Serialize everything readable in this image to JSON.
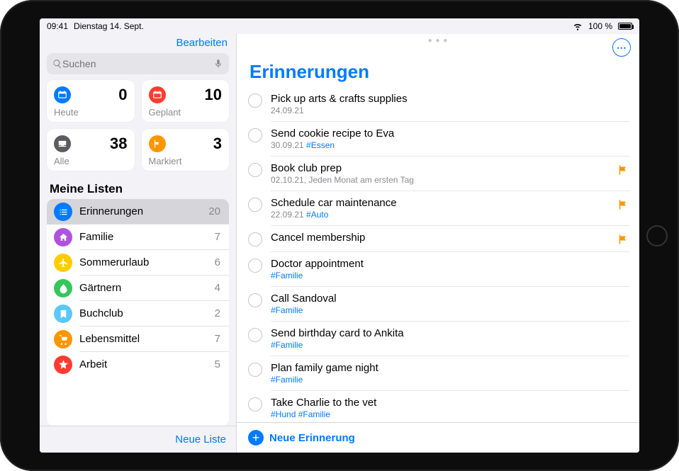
{
  "statusbar": {
    "time": "09:41",
    "date": "Dienstag 14. Sept.",
    "battery": "100 %"
  },
  "sidebar": {
    "edit": "Bearbeiten",
    "search_placeholder": "Suchen",
    "smart": [
      {
        "label": "Heute",
        "count": "0",
        "color": "#007aff",
        "icon": "calendar"
      },
      {
        "label": "Geplant",
        "count": "10",
        "color": "#ff3b30",
        "icon": "calendar"
      },
      {
        "label": "Alle",
        "count": "38",
        "color": "#5b5b60",
        "icon": "tray"
      },
      {
        "label": "Markiert",
        "count": "3",
        "color": "#ff9500",
        "icon": "flag"
      }
    ],
    "myLists": "Meine Listen",
    "lists": [
      {
        "name": "Erinnerungen",
        "count": "20",
        "color": "#007aff",
        "icon": "list",
        "selected": true
      },
      {
        "name": "Familie",
        "count": "7",
        "color": "#af52de",
        "icon": "house"
      },
      {
        "name": "Sommerurlaub",
        "count": "6",
        "color": "#ffcc00",
        "icon": "plane"
      },
      {
        "name": "Gärtnern",
        "count": "4",
        "color": "#34c759",
        "icon": "leaf"
      },
      {
        "name": "Buchclub",
        "count": "2",
        "color": "#5ac8fa",
        "icon": "bookmark"
      },
      {
        "name": "Lebensmittel",
        "count": "7",
        "color": "#ff9500",
        "icon": "cart"
      },
      {
        "name": "Arbeit",
        "count": "5",
        "color": "#ff3b30",
        "icon": "star"
      }
    ],
    "newList": "Neue Liste"
  },
  "main": {
    "title": "Erinnerungen",
    "newReminder": "Neue Erinnerung",
    "items": [
      {
        "title": "Pick up arts & crafts supplies",
        "date": "24.09.21",
        "tags": "",
        "flagged": false
      },
      {
        "title": "Send cookie recipe to Eva",
        "date": "30.09.21",
        "tags": "#Essen",
        "flagged": false
      },
      {
        "title": "Book club prep",
        "date": "02.10.21, Jeden Monat am ersten Tag",
        "tags": "",
        "flagged": true
      },
      {
        "title": "Schedule car maintenance",
        "date": "22.09.21",
        "tags": "#Auto",
        "flagged": true
      },
      {
        "title": "Cancel membership",
        "date": "",
        "tags": "",
        "flagged": true
      },
      {
        "title": "Doctor appointment",
        "date": "",
        "tags": "#Familie",
        "flagged": false
      },
      {
        "title": "Call Sandoval",
        "date": "",
        "tags": "#Familie",
        "flagged": false
      },
      {
        "title": "Send birthday card to Ankita",
        "date": "",
        "tags": "#Familie",
        "flagged": false
      },
      {
        "title": "Plan family game night",
        "date": "",
        "tags": "#Familie",
        "flagged": false
      },
      {
        "title": "Take Charlie to the vet",
        "date": "",
        "tags": "#Hund #Familie",
        "flagged": false
      }
    ]
  }
}
